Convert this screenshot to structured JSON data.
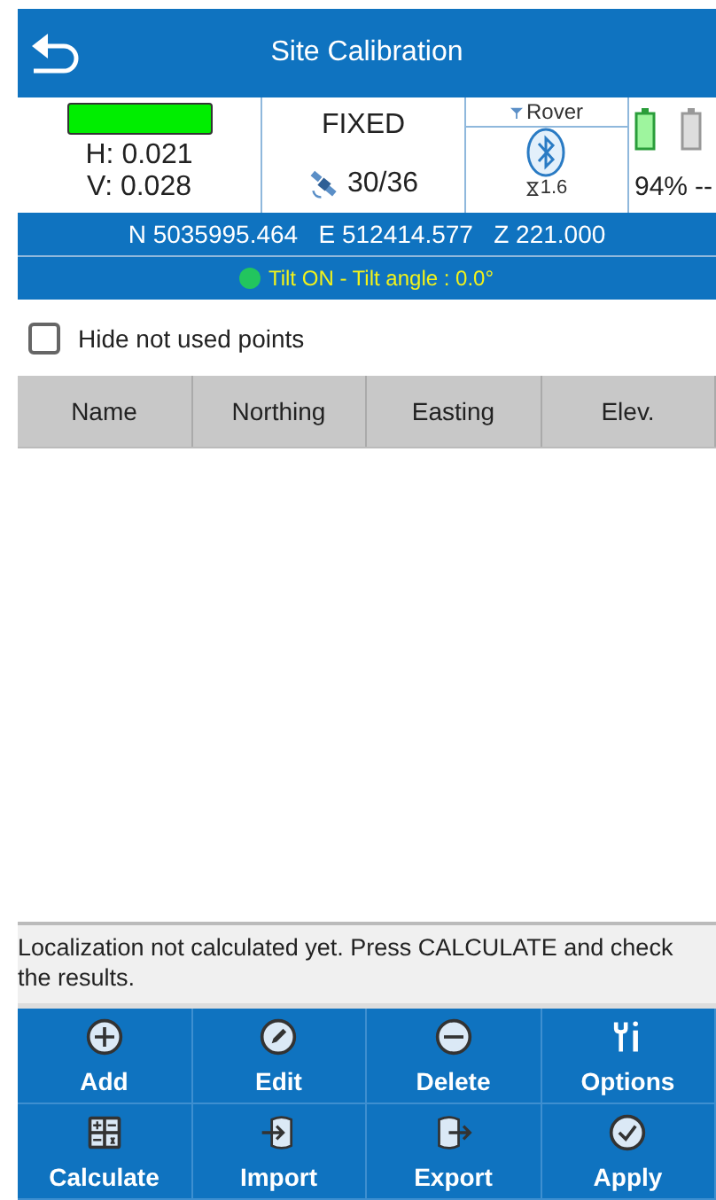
{
  "window": {
    "title": "Site Calibration"
  },
  "status": {
    "precision_h": "H: 0.021",
    "precision_v": "V: 0.028",
    "solution": "FIXED",
    "satellites": "30/36",
    "mode": "Rover",
    "age": "1.6",
    "battery_1": "94%",
    "battery_2": "--"
  },
  "coordinates": "N 5035995.464   E 512414.577   Z 221.000",
  "tilt": {
    "text": "Tilt ON - Tilt angle : 0.0°",
    "color": "#22c55e"
  },
  "hide_unused": {
    "label": "Hide not used points",
    "checked": false
  },
  "table": {
    "columns": [
      "Name",
      "Northing",
      "Easting",
      "Elev."
    ]
  },
  "message": "Localization not calculated yet. Press CALCULATE and check the results.",
  "buttons": [
    {
      "label": "Add",
      "kind": "add"
    },
    {
      "label": "Edit",
      "kind": "edit"
    },
    {
      "label": "Delete",
      "kind": "delete"
    },
    {
      "label": "Options",
      "kind": "options"
    },
    {
      "label": "Calculate",
      "kind": "calculate"
    },
    {
      "label": "Import",
      "kind": "import"
    },
    {
      "label": "Export",
      "kind": "export"
    },
    {
      "label": "Apply",
      "kind": "apply"
    }
  ]
}
